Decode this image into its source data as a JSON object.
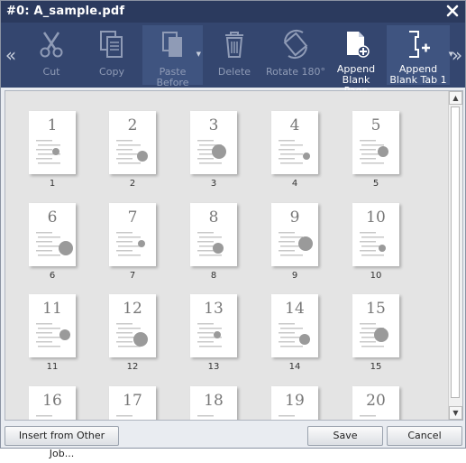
{
  "window": {
    "title": "#0: A_sample.pdf"
  },
  "toolbar": {
    "buttons": [
      {
        "label": "Cut"
      },
      {
        "label": "Copy"
      },
      {
        "label": "Paste Before"
      },
      {
        "label": "Delete"
      },
      {
        "label": "Rotate 180°"
      },
      {
        "label1": "Append",
        "label2": "Blank Page"
      },
      {
        "label1": "Append",
        "label2": "Blank Tab 1"
      }
    ]
  },
  "pages": [
    {
      "num": "1",
      "label": "1"
    },
    {
      "num": "2",
      "label": "2"
    },
    {
      "num": "3",
      "label": "3"
    },
    {
      "num": "4",
      "label": "4"
    },
    {
      "num": "5",
      "label": "5"
    },
    {
      "num": "6",
      "label": "6"
    },
    {
      "num": "7",
      "label": "7"
    },
    {
      "num": "8",
      "label": "8"
    },
    {
      "num": "9",
      "label": "9"
    },
    {
      "num": "10",
      "label": "10"
    },
    {
      "num": "11",
      "label": "11"
    },
    {
      "num": "12",
      "label": "12"
    },
    {
      "num": "13",
      "label": "13"
    },
    {
      "num": "14",
      "label": "14"
    },
    {
      "num": "15",
      "label": "15"
    },
    {
      "num": "16",
      "label": ""
    },
    {
      "num": "17",
      "label": ""
    },
    {
      "num": "18",
      "label": ""
    },
    {
      "num": "19",
      "label": ""
    },
    {
      "num": "20",
      "label": ""
    }
  ],
  "footer": {
    "insert_label": "Insert from Other Job...",
    "save_label": "Save",
    "cancel_label": "Cancel"
  }
}
